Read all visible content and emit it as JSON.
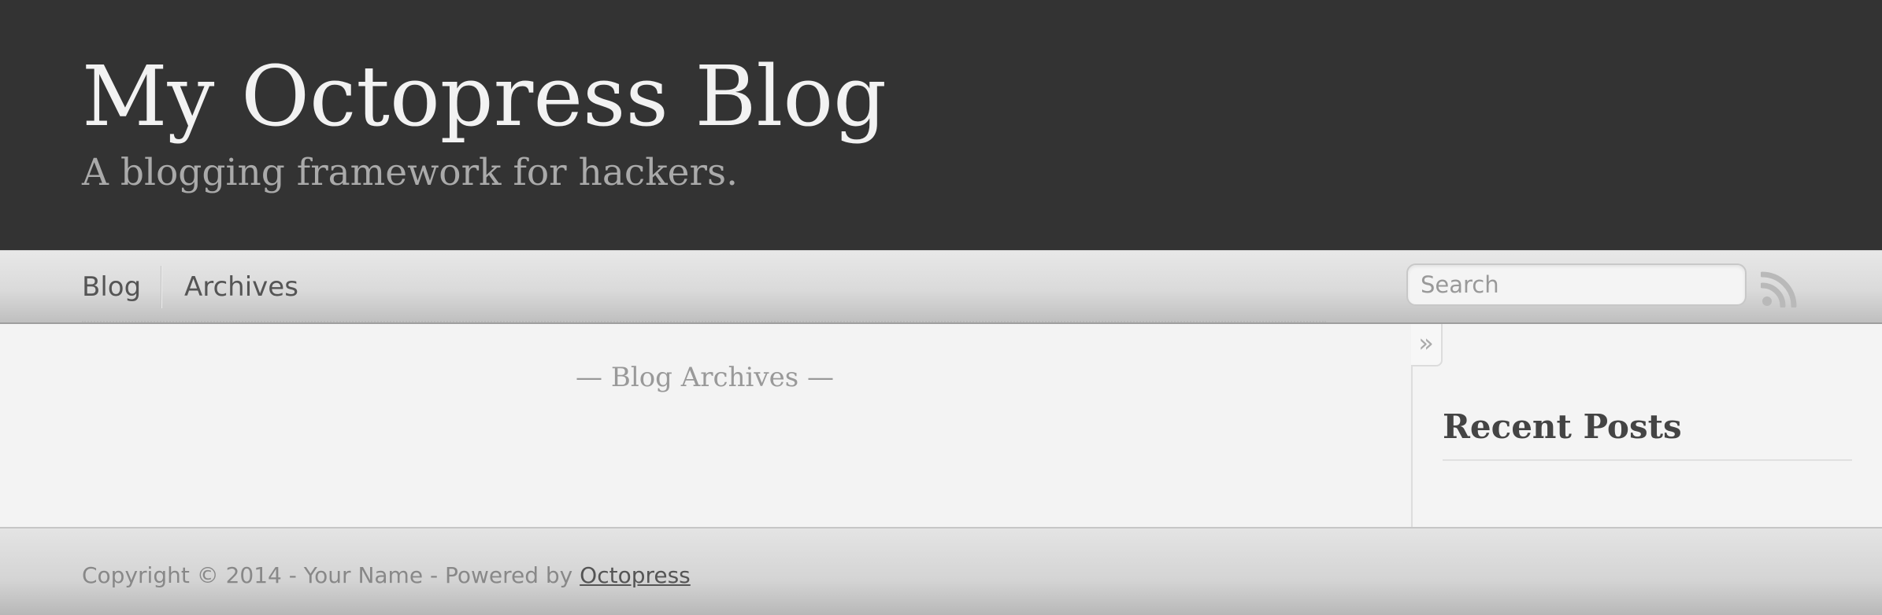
{
  "header": {
    "title": "My Octopress Blog",
    "subtitle": "A blogging framework for hackers."
  },
  "nav": {
    "items": [
      {
        "label": "Blog"
      },
      {
        "label": "Archives"
      }
    ],
    "search": {
      "placeholder": "Search",
      "value": ""
    },
    "rss_icon": "rss-icon"
  },
  "main": {
    "heading": "— Blog Archives —"
  },
  "sidebar": {
    "toggle_glyph": "»",
    "recent_posts_title": "Recent Posts"
  },
  "footer": {
    "copyright_text": "Copyright © 2014 - Your Name - Powered by ",
    "link_label": "Octopress"
  },
  "colors": {
    "header_bg": "#333333",
    "title_text": "#f2f2f2",
    "subtitle_text": "#aaaaaa",
    "page_bg": "#f3f3f3"
  }
}
